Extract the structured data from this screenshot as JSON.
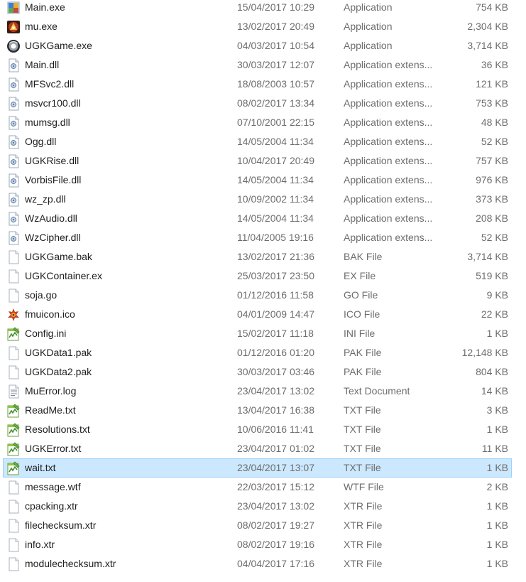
{
  "files": [
    {
      "name": "Main.exe",
      "date": "15/04/2017 10:29",
      "type": "Application",
      "size": "754 KB",
      "icon": "main-exe-icon"
    },
    {
      "name": "mu.exe",
      "date": "13/02/2017 20:49",
      "type": "Application",
      "size": "2,304 KB",
      "icon": "mu-exe-icon"
    },
    {
      "name": "UGKGame.exe",
      "date": "04/03/2017 10:54",
      "type": "Application",
      "size": "3,714 KB",
      "icon": "ugkgame-exe-icon"
    },
    {
      "name": "Main.dll",
      "date": "30/03/2017 12:07",
      "type": "Application extens...",
      "size": "36 KB",
      "icon": "dll-icon"
    },
    {
      "name": "MFSvc2.dll",
      "date": "18/08/2003 10:57",
      "type": "Application extens...",
      "size": "121 KB",
      "icon": "dll-icon"
    },
    {
      "name": "msvcr100.dll",
      "date": "08/02/2017 13:34",
      "type": "Application extens...",
      "size": "753 KB",
      "icon": "dll-icon"
    },
    {
      "name": "mumsg.dll",
      "date": "07/10/2001 22:15",
      "type": "Application extens...",
      "size": "48 KB",
      "icon": "dll-icon"
    },
    {
      "name": "Ogg.dll",
      "date": "14/05/2004 11:34",
      "type": "Application extens...",
      "size": "52 KB",
      "icon": "dll-icon"
    },
    {
      "name": "UGKRise.dll",
      "date": "10/04/2017 20:49",
      "type": "Application extens...",
      "size": "757 KB",
      "icon": "dll-icon"
    },
    {
      "name": "VorbisFile.dll",
      "date": "14/05/2004 11:34",
      "type": "Application extens...",
      "size": "976 KB",
      "icon": "dll-icon"
    },
    {
      "name": "wz_zp.dll",
      "date": "10/09/2002 11:34",
      "type": "Application extens...",
      "size": "373 KB",
      "icon": "dll-icon"
    },
    {
      "name": "WzAudio.dll",
      "date": "14/05/2004 11:34",
      "type": "Application extens...",
      "size": "208 KB",
      "icon": "dll-icon"
    },
    {
      "name": "WzCipher.dll",
      "date": "11/04/2005 19:16",
      "type": "Application extens...",
      "size": "52 KB",
      "icon": "dll-icon"
    },
    {
      "name": "UGKGame.bak",
      "date": "13/02/2017 21:36",
      "type": "BAK File",
      "size": "3,714 KB",
      "icon": "blank-file-icon"
    },
    {
      "name": "UGKContainer.ex",
      "date": "25/03/2017 23:50",
      "type": "EX File",
      "size": "519 KB",
      "icon": "blank-file-icon"
    },
    {
      "name": "soja.go",
      "date": "01/12/2016 11:58",
      "type": "GO File",
      "size": "9 KB",
      "icon": "blank-file-icon"
    },
    {
      "name": "fmuicon.ico",
      "date": "04/01/2009 14:47",
      "type": "ICO File",
      "size": "22 KB",
      "icon": "ico-image-icon"
    },
    {
      "name": "Config.ini",
      "date": "15/02/2017 11:18",
      "type": "INI File",
      "size": "1 KB",
      "icon": "notepad-plus-icon"
    },
    {
      "name": "UGKData1.pak",
      "date": "01/12/2016 01:20",
      "type": "PAK File",
      "size": "12,148 KB",
      "icon": "blank-file-icon"
    },
    {
      "name": "UGKData2.pak",
      "date": "30/03/2017 03:46",
      "type": "PAK File",
      "size": "804 KB",
      "icon": "blank-file-icon"
    },
    {
      "name": "MuError.log",
      "date": "23/04/2017 13:02",
      "type": "Text Document",
      "size": "14 KB",
      "icon": "text-document-icon"
    },
    {
      "name": "ReadMe.txt",
      "date": "13/04/2017 16:38",
      "type": "TXT File",
      "size": "3 KB",
      "icon": "notepad-plus-icon"
    },
    {
      "name": "Resolutions.txt",
      "date": "10/06/2016 11:41",
      "type": "TXT File",
      "size": "1 KB",
      "icon": "notepad-plus-icon"
    },
    {
      "name": "UGKError.txt",
      "date": "23/04/2017 01:02",
      "type": "TXT File",
      "size": "11 KB",
      "icon": "notepad-plus-icon"
    },
    {
      "name": "wait.txt",
      "date": "23/04/2017 13:07",
      "type": "TXT File",
      "size": "1 KB",
      "icon": "notepad-plus-icon",
      "selected": true
    },
    {
      "name": "message.wtf",
      "date": "22/03/2017 15:12",
      "type": "WTF File",
      "size": "2 KB",
      "icon": "blank-file-icon"
    },
    {
      "name": "cpacking.xtr",
      "date": "23/04/2017 13:02",
      "type": "XTR File",
      "size": "1 KB",
      "icon": "blank-file-icon"
    },
    {
      "name": "filechecksum.xtr",
      "date": "08/02/2017 19:27",
      "type": "XTR File",
      "size": "1 KB",
      "icon": "blank-file-icon"
    },
    {
      "name": "info.xtr",
      "date": "08/02/2017 19:16",
      "type": "XTR File",
      "size": "1 KB",
      "icon": "blank-file-icon"
    },
    {
      "name": "modulechecksum.xtr",
      "date": "04/04/2017 17:16",
      "type": "XTR File",
      "size": "1 KB",
      "icon": "blank-file-icon"
    }
  ],
  "colors": {
    "selection_fill": "#cce8ff",
    "selection_border": "#99d1ff",
    "name_text": "#1e1e1e",
    "meta_text": "#6d6d6d"
  }
}
